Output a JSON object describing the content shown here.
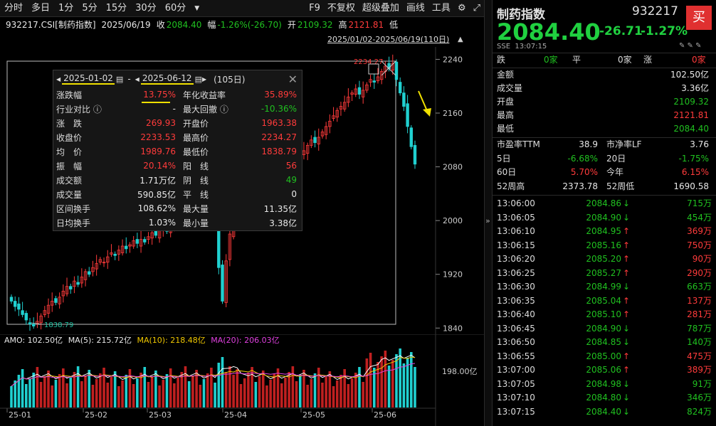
{
  "toolbar": {
    "periods": [
      "分时",
      "多日",
      "1分",
      "5分",
      "15分",
      "30分",
      "60分"
    ],
    "tools": [
      "F9",
      "不复权",
      "超级叠加",
      "画线",
      "工具"
    ]
  },
  "infobar": {
    "code": "932217.CSI[制药指数]",
    "date": "2025/06/19",
    "close_label": "收",
    "close": "2084.40",
    "amp_label": "幅",
    "amp": "-1.26%(-26.70)",
    "open_label": "开",
    "open": "2109.32",
    "high_label": "高",
    "high": "2121.81",
    "low_label": "低"
  },
  "range_text": "2025/01/02-2025/06/19(110日)",
  "chart_data": {
    "type": "candlestick",
    "title": "",
    "y_ticks": [
      2240,
      2160,
      2080,
      2000,
      1920,
      1840
    ],
    "ylim": [
      1835,
      2250
    ],
    "x_tick_labels": [
      "25-01",
      "25-02",
      "25-03",
      "25-04",
      "25-05",
      "25-06"
    ],
    "annotations": {
      "high": "2234.27",
      "low": "1838.79"
    },
    "close_series": [
      1880,
      1872,
      1868,
      1860,
      1852,
      1846,
      1843,
      1850,
      1858,
      1866,
      1874,
      1880,
      1878,
      1886,
      1895,
      1902,
      1898,
      1910,
      1905,
      1916,
      1924,
      1920,
      1930,
      1936,
      1942,
      1938,
      1946,
      1952,
      1948,
      1956,
      1962,
      1958,
      1964,
      1970,
      1966,
      1972,
      1968,
      1976,
      1982,
      1978,
      1986,
      1990,
      1984,
      1992,
      1998,
      1994,
      2000,
      2004,
      1998,
      2002,
      2008,
      2012,
      2006,
      2010,
      2014,
      2008,
      1930,
      1880,
      1940,
      1980,
      2000,
      2010,
      2016,
      2020,
      2024,
      2030,
      2026,
      2034,
      2040,
      2046,
      2052,
      2058,
      2064,
      2070,
      2078,
      2086,
      2094,
      2100,
      2096,
      2104,
      2112,
      2120,
      2116,
      2124,
      2132,
      2140,
      2148,
      2156,
      2164,
      2170,
      2176,
      2184,
      2190,
      2196,
      2188,
      2194,
      2202,
      2210,
      2206,
      2214,
      2222,
      2230,
      2226,
      2234,
      2210,
      2190,
      2170,
      2140,
      2110,
      2084
    ],
    "volume_legend": {
      "amo": "AMO: 102.50亿",
      "ma5": "MA(5): 215.72亿",
      "ma10": "MA(10): 218.48亿",
      "ma20": "MA(20): 206.03亿",
      "axis_label": "198.00亿"
    }
  },
  "popup": {
    "start_date": "2025-01-02",
    "dash": "-",
    "end_date": "2025-06-12",
    "days": "(105日)",
    "rows": [
      [
        "涨跌幅",
        "13.75%",
        "年化收益率",
        "35.89%"
      ],
      [
        "行业对比 ⓘ",
        "-",
        "最大回撤 ⓘ",
        "-10.36%"
      ],
      [
        "涨　跌",
        "269.93",
        "开盘价",
        "1963.38"
      ],
      [
        "收盘价",
        "2233.53",
        "最高价",
        "2234.27"
      ],
      [
        "均　价",
        "1989.76",
        "最低价",
        "1838.79"
      ],
      [
        "振　幅",
        "20.14%",
        "阳　线",
        "56"
      ],
      [
        "成交额",
        "1.71万亿",
        "阴　线",
        "49"
      ],
      [
        "成交量",
        "590.85亿",
        "平　线",
        "0"
      ],
      [
        "区间换手",
        "108.62%",
        "最大量",
        "11.35亿"
      ],
      [
        "日均换手",
        "1.03%",
        "最小量",
        "3.38亿"
      ]
    ]
  },
  "right": {
    "title": "制药指数",
    "code": "932217",
    "buy": "买",
    "price": "2084.40",
    "change": "-26.71",
    "change_pct": "-1.27%",
    "exchange": "SSE",
    "time": "13:07:15",
    "breadth": {
      "down_label": "跌",
      "down": "0家",
      "flat_label": "平",
      "flat": "0家",
      "up_label": "涨",
      "up": "0家"
    },
    "stats": [
      [
        "金额",
        "102.50亿"
      ],
      [
        "成交量",
        "3.36亿"
      ],
      [
        "开盘",
        "2109.32"
      ],
      [
        "最高",
        "2121.81"
      ],
      [
        "最低",
        "2084.40"
      ]
    ],
    "valuation": [
      [
        "市盈率TTM",
        "38.9",
        "市净率LF",
        "3.76"
      ],
      [
        "5日",
        "-6.68%",
        "20日",
        "-1.75%"
      ],
      [
        "60日",
        "5.70%",
        "今年",
        "6.15%"
      ],
      [
        "52周高",
        "2373.78",
        "52周低",
        "1690.58"
      ]
    ],
    "ticks": [
      [
        "13:06:00",
        "2084.86",
        "down",
        "715万"
      ],
      [
        "13:06:05",
        "2084.90",
        "down",
        "454万"
      ],
      [
        "13:06:10",
        "2084.95",
        "up",
        "369万"
      ],
      [
        "13:06:15",
        "2085.16",
        "up",
        "750万"
      ],
      [
        "13:06:20",
        "2085.20",
        "up",
        "90万"
      ],
      [
        "13:06:25",
        "2085.27",
        "up",
        "290万"
      ],
      [
        "13:06:30",
        "2084.99",
        "down",
        "663万"
      ],
      [
        "13:06:35",
        "2085.04",
        "up",
        "137万"
      ],
      [
        "13:06:40",
        "2085.10",
        "up",
        "281万"
      ],
      [
        "13:06:45",
        "2084.90",
        "down",
        "787万"
      ],
      [
        "13:06:50",
        "2084.85",
        "down",
        "140万"
      ],
      [
        "13:06:55",
        "2085.00",
        "up",
        "475万"
      ],
      [
        "13:07:00",
        "2085.06",
        "up",
        "389万"
      ],
      [
        "13:07:05",
        "2084.98",
        "down",
        "91万"
      ],
      [
        "13:07:10",
        "2084.80",
        "down",
        "346万"
      ],
      [
        "13:07:15",
        "2084.40",
        "down",
        "824万"
      ]
    ]
  }
}
